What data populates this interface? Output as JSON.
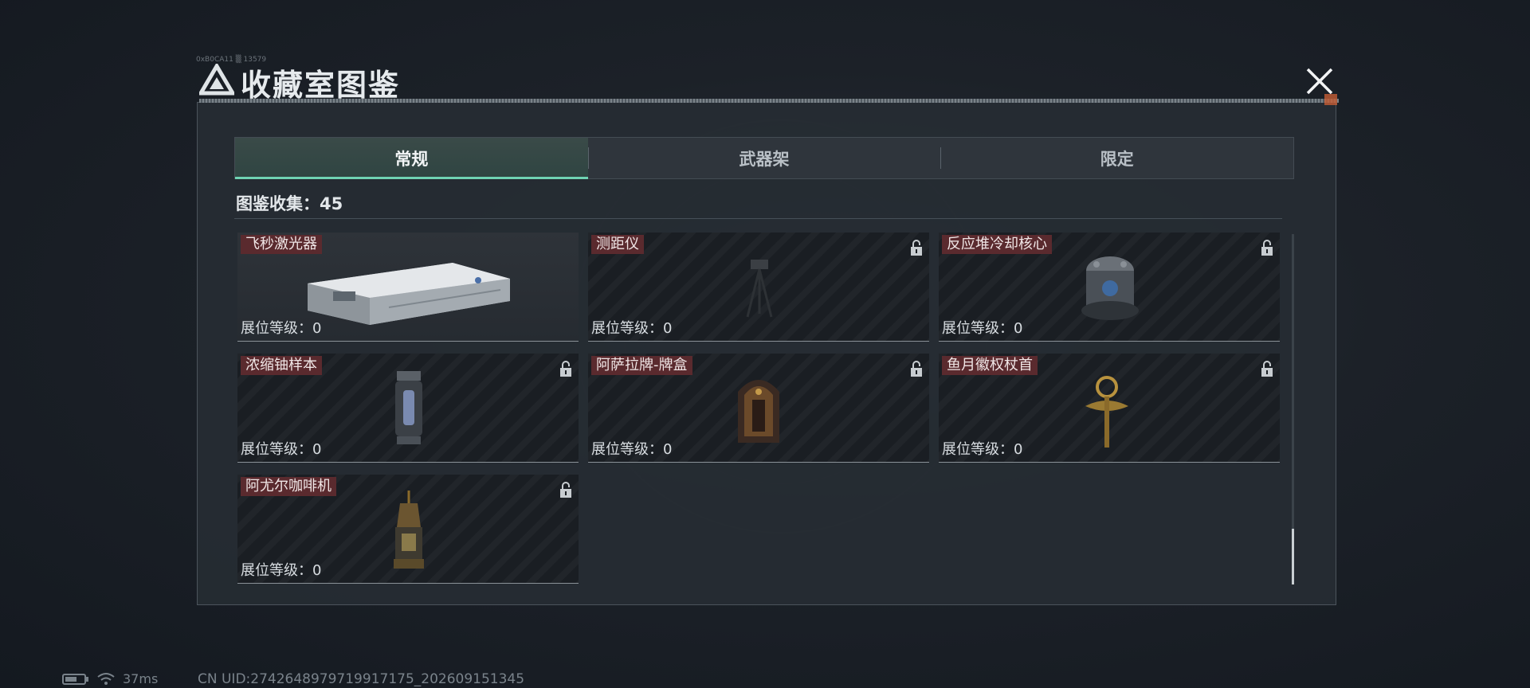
{
  "dialog": {
    "title": "收藏室图鉴",
    "title_small": "0xB0CA11 ▒ 13579",
    "close_icon": "close-x-icon"
  },
  "tabs": [
    {
      "label": "常规",
      "active": true
    },
    {
      "label": "武器架",
      "active": false
    },
    {
      "label": "限定",
      "active": false
    }
  ],
  "collection": {
    "label": "图鉴收集：45"
  },
  "items": [
    {
      "name": "飞秒激光器",
      "level": "展位等级：0",
      "locked": false,
      "icon": "laser-device-icon"
    },
    {
      "name": "测距仪",
      "level": "展位等级：0",
      "locked": true,
      "icon": "tripod-rangefinder-icon"
    },
    {
      "name": "反应堆冷却核心",
      "level": "展位等级：0",
      "locked": true,
      "icon": "reactor-core-icon"
    },
    {
      "name": "浓缩铀样本",
      "level": "展位等级：0",
      "locked": true,
      "icon": "uranium-canister-icon"
    },
    {
      "name": "阿萨拉牌-牌盒",
      "level": "展位等级：0",
      "locked": true,
      "icon": "card-box-icon"
    },
    {
      "name": "鱼月徽权杖首",
      "level": "展位等级：0",
      "locked": true,
      "icon": "scepter-head-icon"
    },
    {
      "name": "阿尤尔咖啡机",
      "level": "展位等级：0",
      "locked": true,
      "icon": "coffee-machine-icon"
    }
  ],
  "status": {
    "ping": "37ms",
    "uid": "CN UID:2742648979719917175_202609151345"
  },
  "colors": {
    "accent": "#6fd3b3",
    "name_badge": "#5a2a2e"
  }
}
